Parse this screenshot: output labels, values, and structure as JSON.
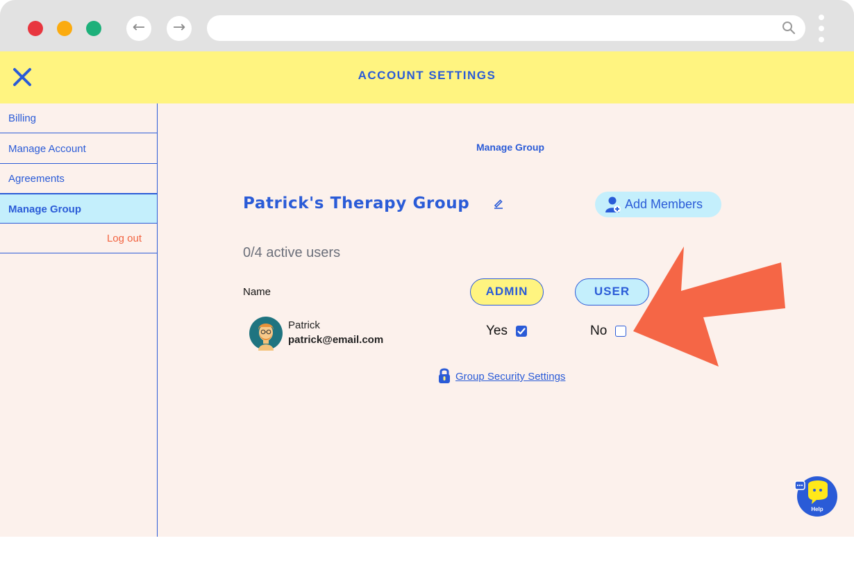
{
  "browser": {
    "back_icon": "arrow-left",
    "forward_icon": "arrow-right",
    "search_icon": "magnifier",
    "menu_icon": "vertical-dots"
  },
  "header": {
    "title": "ACCOUNT SETTINGS",
    "close_icon": "x"
  },
  "sidebar": {
    "items": [
      {
        "label": "Billing",
        "active": false
      },
      {
        "label": "Manage Account",
        "active": false
      },
      {
        "label": "Agreements",
        "active": false
      },
      {
        "label": "Manage Group",
        "active": true
      }
    ],
    "logout_label": "Log out"
  },
  "main": {
    "subtitle": "Manage Group",
    "group_name": "Patrick's Therapy Group",
    "add_members_label": "Add Members",
    "active_users": "0/4 active users",
    "table": {
      "name_header": "Name",
      "admin_header": "ADMIN",
      "user_header": "USER",
      "members": [
        {
          "name": "Patrick",
          "email": "patrick@email.com",
          "admin_label": "Yes",
          "admin_checked": true,
          "user_label": "No",
          "user_checked": false
        }
      ]
    },
    "security_link": "Group Security Settings"
  },
  "help": {
    "label": "Help"
  },
  "colors": {
    "brand_blue": "#2a5bd7",
    "header_yellow": "#fff480",
    "light_cyan": "#c4effc",
    "page_bg": "#fcf1ec",
    "accent_orange": "#f26340"
  }
}
